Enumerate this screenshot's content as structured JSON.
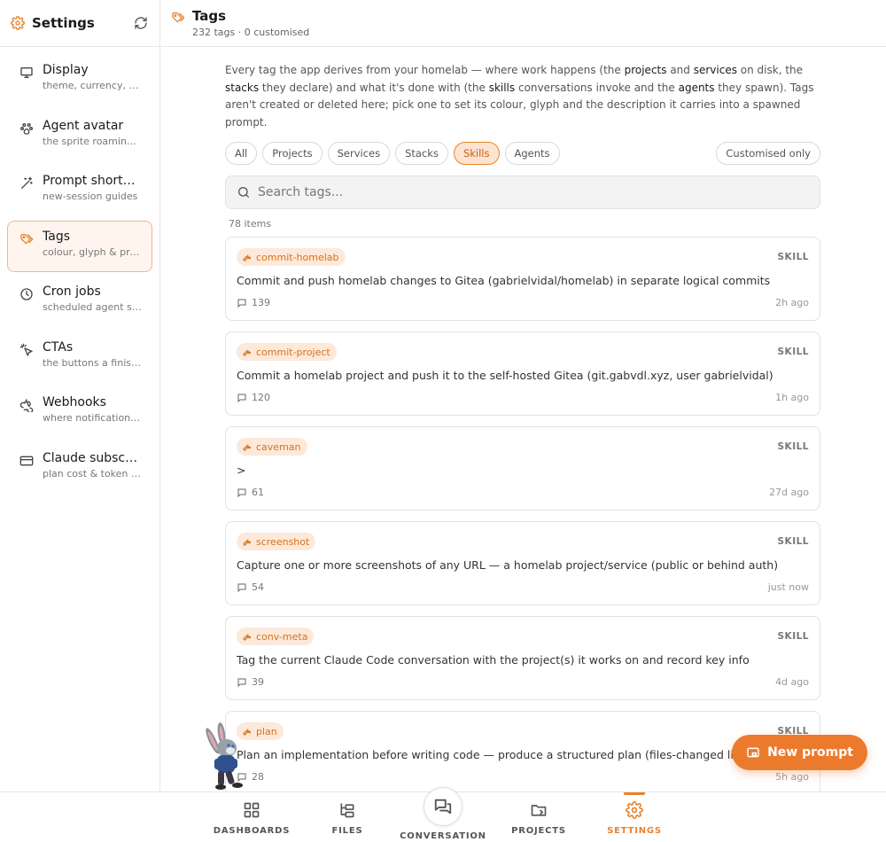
{
  "sidebar": {
    "title": "Settings",
    "items": [
      {
        "label": "Display",
        "sub": "theme, currency, timezone"
      },
      {
        "label": "Agent avatar",
        "sub": "the sprite roaming the screen"
      },
      {
        "label": "Prompt shortcuts",
        "sub": "new-session guides"
      },
      {
        "label": "Tags",
        "sub": "colour, glyph & prompt context"
      },
      {
        "label": "Cron jobs",
        "sub": "scheduled agent sessions"
      },
      {
        "label": "CTAs",
        "sub": "the buttons a finished run shows"
      },
      {
        "label": "Webhooks",
        "sub": "where notifications go"
      },
      {
        "label": "Claude subscription",
        "sub": "plan cost & token budget"
      }
    ]
  },
  "header": {
    "title": "Tags",
    "subtitle": "232 tags · 0 customised"
  },
  "intro": {
    "t1": "Every tag the app derives from your homelab — where work happens (the ",
    "k1": "projects",
    "t2": " and ",
    "k2": "services",
    "t3": " on disk, the ",
    "k3": "stacks",
    "t4": " they declare) and what it's done with (the ",
    "k4": "skills",
    "t5": " conversations invoke and the ",
    "k5": "agents",
    "t6": " they spawn). Tags aren't created or deleted here; pick one to set its colour, glyph and the description it carries into a spawned prompt."
  },
  "filters": {
    "all": "All",
    "projects": "Projects",
    "services": "Services",
    "stacks": "Stacks",
    "skills": "Skills",
    "agents": "Agents",
    "customised": "Customised only"
  },
  "search": {
    "placeholder": "Search tags..."
  },
  "count": "78 items",
  "cards": [
    {
      "name": "commit-homelab",
      "kind": "SKILL",
      "desc": "Commit and push homelab changes to Gitea (gabrielvidal/homelab) in separate logical commits",
      "comments": "139",
      "time": "2h ago"
    },
    {
      "name": "commit-project",
      "kind": "SKILL",
      "desc": "Commit a homelab project and push it to the self-hosted Gitea (git.gabvdl.xyz, user gabrielvidal)",
      "comments": "120",
      "time": "1h ago"
    },
    {
      "name": "caveman",
      "kind": "SKILL",
      "desc": ">",
      "comments": "61",
      "time": "27d ago"
    },
    {
      "name": "screenshot",
      "kind": "SKILL",
      "desc": "Capture one or more screenshots of any URL — a homelab project/service (public or behind auth)",
      "comments": "54",
      "time": "just now"
    },
    {
      "name": "conv-meta",
      "kind": "SKILL",
      "desc": "Tag the current Claude Code conversation with the project(s) it works on and record key info",
      "comments": "39",
      "time": "4d ago"
    },
    {
      "name": "plan",
      "kind": "SKILL",
      "desc": "Plan an implementation before writing code — produce a structured plan (files-changed list)",
      "comments": "28",
      "time": "5h ago"
    }
  ],
  "new_prompt": "New prompt",
  "nav": {
    "dashboards": "DASHBOARDS",
    "files": "FILES",
    "conversation": "CONVERSATION",
    "projects": "PROJECTS",
    "settings": "SETTINGS"
  },
  "colors": {
    "accent": "#e8832e",
    "accent_bg": "#fde9da"
  }
}
